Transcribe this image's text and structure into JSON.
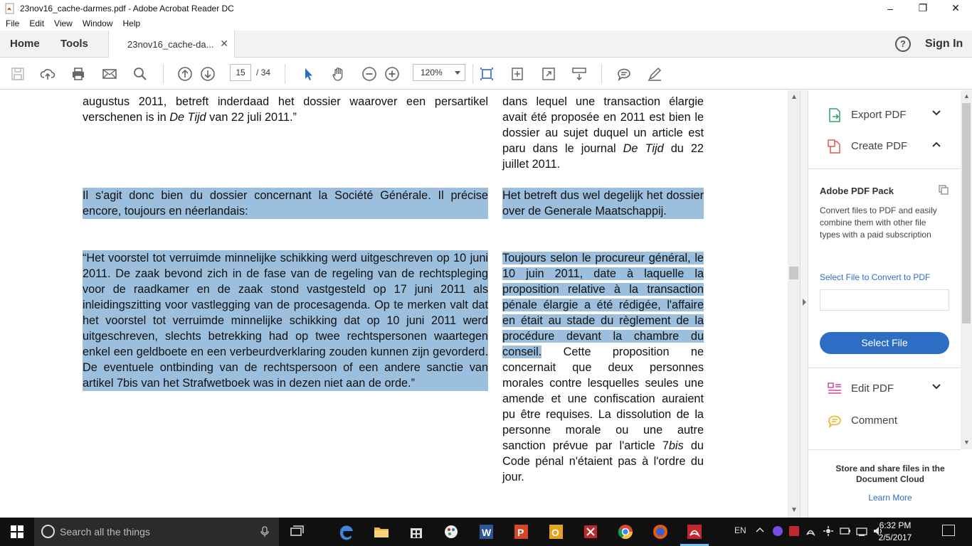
{
  "window": {
    "title": "23nov16_cache-darmes.pdf - Adobe Acrobat Reader DC",
    "minimize": "–",
    "restore": "❐",
    "close": "✕"
  },
  "menu": [
    "File",
    "Edit",
    "View",
    "Window",
    "Help"
  ],
  "tabs": {
    "home": "Home",
    "tools": "Tools",
    "doc": "23nov16_cache-da...",
    "doc_close": "✕",
    "help": "?",
    "signin": "Sign In"
  },
  "toolbar": {
    "page_current": "15",
    "page_total": "/  34",
    "zoom": "120%"
  },
  "document": {
    "left_top": "augustus 2011, betreft inderdaad het dossier waarover een persartikel verschenen is in De Tijd van 22 juli 2011.”",
    "left_top_a": "augustus 2011, betreft inderdaad het dossier waarover een persartikel verschenen is in ",
    "left_top_em": "De Tijd",
    "left_top_b": " van 22 juli 2011.”",
    "right_top_a": "dans lequel une transaction élargie avait été proposée en 2011 est bien le dossier au sujet duquel un article est paru dans le journal ",
    "right_top_em": "De Tijd",
    "right_top_b": " du 22 juillet 2011.",
    "left_mid": "Il s'agit donc bien du dossier concernant la Société Générale. Il précise encore, toujours en néerlandais:",
    "right_mid": "Het betreft dus wel degelijk het dossier over de Generale Maatschappij.",
    "left_quote": "“Het voorstel tot verruimde minnelijke schikking werd uitgeschreven op 10 juni 2011. De zaak bevond zich in de fase van de regeling van de rechtspleging voor de raadkamer en de zaak stond vastgesteld op 17 juni 2011 als inleidingszitting voor vastlegging van de procesagenda. Op te merken valt dat het voorstel tot verruimde minnelijke schikking dat op 10 juni 2011 werd uitgeschreven, slechts betrekking had op twee rechtspersonen waartegen enkel een geldboete en een verbeurdverklaring zouden kunnen zijn gevorderd. De eventuele ontbinding van de rechtspersoon of een andere sanctie van artikel 7bis van het Strafwetboek was in dezen niet aan de orde.”",
    "right_quote_hl": "Toujours selon le procureur général, le 10 juin 2011, date à laquelle la proposition relative à la transaction pénale élargie a été rédigée, l'affaire en était au stade du règlement de la procédure devant la chambre du conseil.",
    "right_quote_a": " Cette proposition ne concernait que deux personnes morales contre lesquelles seules une amende et une confiscation auraient pu être requises. La dissolution de la personne morale ou une autre sanction prévue par l'article 7",
    "right_quote_em": "bis",
    "right_quote_b": " du Code pénal n'étaient pas à l'ordre du jour."
  },
  "right_panel": {
    "export_pdf": "Export PDF",
    "create_pdf": "Create PDF",
    "pack_title": "Adobe PDF Pack",
    "pack_desc": "Convert files to PDF and easily combine them with other file types with a paid subscription",
    "select_convert": "Select File to Convert to PDF",
    "select_file": "Select File",
    "edit_pdf": "Edit PDF",
    "comment": "Comment",
    "store": "Store and share files in the Document Cloud",
    "learn_more": "Learn More"
  },
  "taskbar": {
    "search_placeholder": "Search all the things",
    "lang": "EN",
    "time": "6:32 PM",
    "date": "2/5/2017"
  },
  "colors": {
    "highlight": "#9bbfdc",
    "accent": "#2d6ec4",
    "taskbar": "#101010"
  }
}
